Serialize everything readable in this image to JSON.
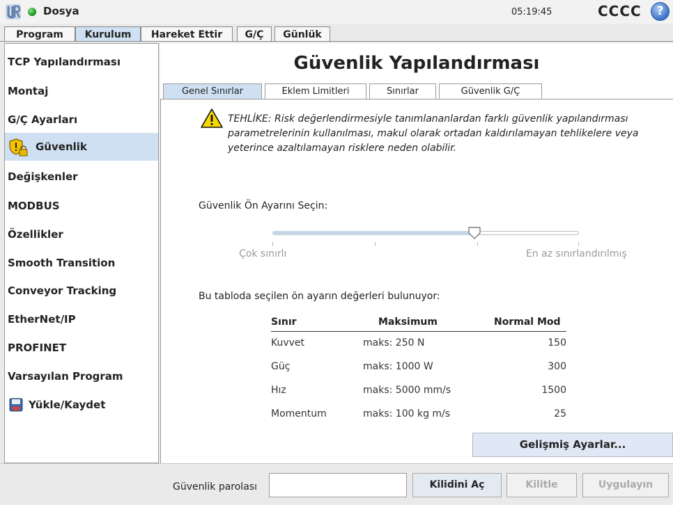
{
  "titlebar": {
    "app_title": "Dosya",
    "clock": "05:19:45",
    "robot_name": "CCCC",
    "help_symbol": "?"
  },
  "top_tabs": [
    {
      "label": "Program",
      "active": false
    },
    {
      "label": "Kurulum",
      "active": true
    },
    {
      "label": "Hareket Ettir",
      "active": false
    },
    {
      "label": "G/Ç",
      "active": false
    },
    {
      "label": "Günlük",
      "active": false
    }
  ],
  "sidebar": {
    "items": [
      {
        "label": "TCP Yapılandırması"
      },
      {
        "label": "Montaj"
      },
      {
        "label": "G/Ç Ayarları"
      },
      {
        "label": "Güvenlik",
        "selected": true,
        "icon": "shield-lock-icon"
      },
      {
        "label": "Değişkenler"
      },
      {
        "label": "MODBUS"
      },
      {
        "label": "Özellikler"
      },
      {
        "label": "Smooth Transition"
      },
      {
        "label": "Conveyor Tracking"
      },
      {
        "label": "EtherNet/IP"
      },
      {
        "label": "PROFINET"
      },
      {
        "label": "Varsayılan Program"
      },
      {
        "label": "Yükle/Kaydet",
        "icon": "floppy-disk-icon"
      }
    ]
  },
  "main": {
    "title": "Güvenlik Yapılandırması",
    "sub_tabs": [
      {
        "label": "Genel Sınırlar",
        "active": true
      },
      {
        "label": "Eklem Limitleri",
        "active": false
      },
      {
        "label": "Sınırlar",
        "active": false
      },
      {
        "label": "Güvenlik G/Ç",
        "active": false
      }
    ],
    "warning": "TEHLİKE: Risk değerlendirmesiyle tanımlananlardan farklı güvenlik yapılandırması parametrelerinin kullanılması, makul olarak ortadan kaldırılamayan tehlikelere veya yeterince azaltılamayan risklere neden olabilir.",
    "preset_label": "Güvenlik Ön Ayarını Seçin:",
    "slider": {
      "min_label": "Çok sınırlı",
      "max_label": "En az sınırlandırılmış",
      "position": 0.66
    },
    "table_caption": "Bu tabloda seçilen ön ayarın değerleri bulunuyor:",
    "table": {
      "headers": [
        "Sınır",
        "Maksimum",
        "Normal Mod"
      ],
      "rows": [
        [
          "Kuvvet",
          "maks: 250 N",
          "150"
        ],
        [
          "Güç",
          "maks: 1000 W",
          "300"
        ],
        [
          "Hız",
          "maks: 5000 mm/s",
          "1500"
        ],
        [
          "Momentum",
          "maks: 100 kg m/s",
          "25"
        ]
      ]
    },
    "advanced_button": "Gelişmiş Ayarlar..."
  },
  "bottom": {
    "password_label": "Güvenlik parolası",
    "password_value": "",
    "unlock_button": "Kilidini Aç",
    "lock_button": "Kilitle",
    "apply_button": "Uygulayın"
  },
  "colors": {
    "accent_selected": "#cfe0f3",
    "status_green": "#1b9a1b",
    "warning_yellow": "#f5d800"
  }
}
